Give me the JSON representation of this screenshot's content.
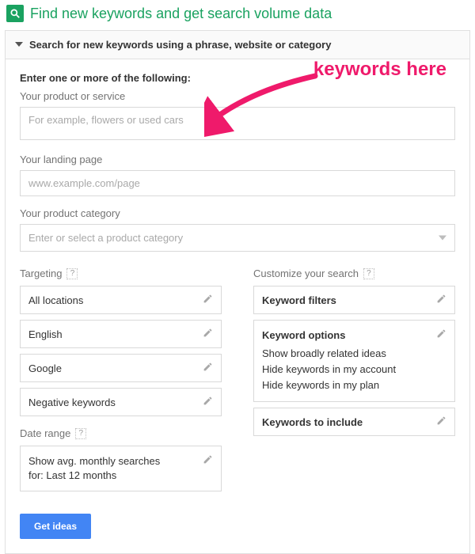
{
  "header": {
    "title": "Find new keywords and get search volume data"
  },
  "accordion": {
    "title": "Search for new keywords using a phrase, website or category"
  },
  "annotation": {
    "text": "keywords here"
  },
  "form": {
    "intro": "Enter one or more of the following:",
    "product": {
      "label": "Your product or service",
      "placeholder": "For example, flowers or used cars"
    },
    "landing": {
      "label": "Your landing page",
      "placeholder": "www.example.com/page"
    },
    "category": {
      "label": "Your product category",
      "placeholder": "Enter or select a product category"
    }
  },
  "targeting": {
    "heading": "Targeting",
    "help": "?",
    "items": [
      "All locations",
      "English",
      "Google",
      "Negative keywords"
    ]
  },
  "dateRange": {
    "heading": "Date range",
    "help": "?",
    "text": "Show avg. monthly searches for: Last 12 months"
  },
  "customize": {
    "heading": "Customize your search",
    "help": "?",
    "filters": "Keyword filters",
    "options": {
      "title": "Keyword options",
      "lines": [
        "Show broadly related ideas",
        "Hide keywords in my account",
        "Hide keywords in my plan"
      ]
    },
    "include": "Keywords to include"
  },
  "submit": {
    "label": "Get ideas"
  }
}
